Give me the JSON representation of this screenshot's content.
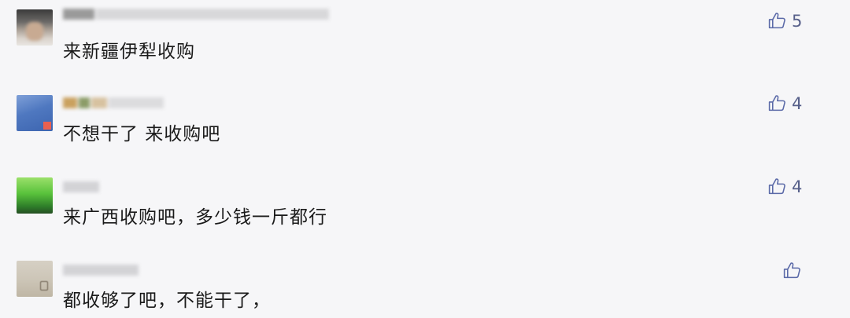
{
  "colors": {
    "background": "#f6f6f8",
    "like_icon": "#5b6aa8",
    "text": "#1a1a1a"
  },
  "comments": [
    {
      "nickname": "",
      "content": "来新疆伊犁收购",
      "likes": "5",
      "avatar": "blurred-photo"
    },
    {
      "nickname": "",
      "content": "不想干了 来收购吧",
      "likes": "4",
      "avatar": "blurred-photo"
    },
    {
      "nickname": "",
      "content": "来广西收购吧，多少钱一斤都行",
      "likes": "4",
      "avatar": "blurred-photo"
    },
    {
      "nickname": "",
      "content": "都收够了吧，不能干了，",
      "likes": "",
      "avatar": "blurred-photo"
    }
  ],
  "icons": {
    "like": "thumbs-up-icon"
  }
}
